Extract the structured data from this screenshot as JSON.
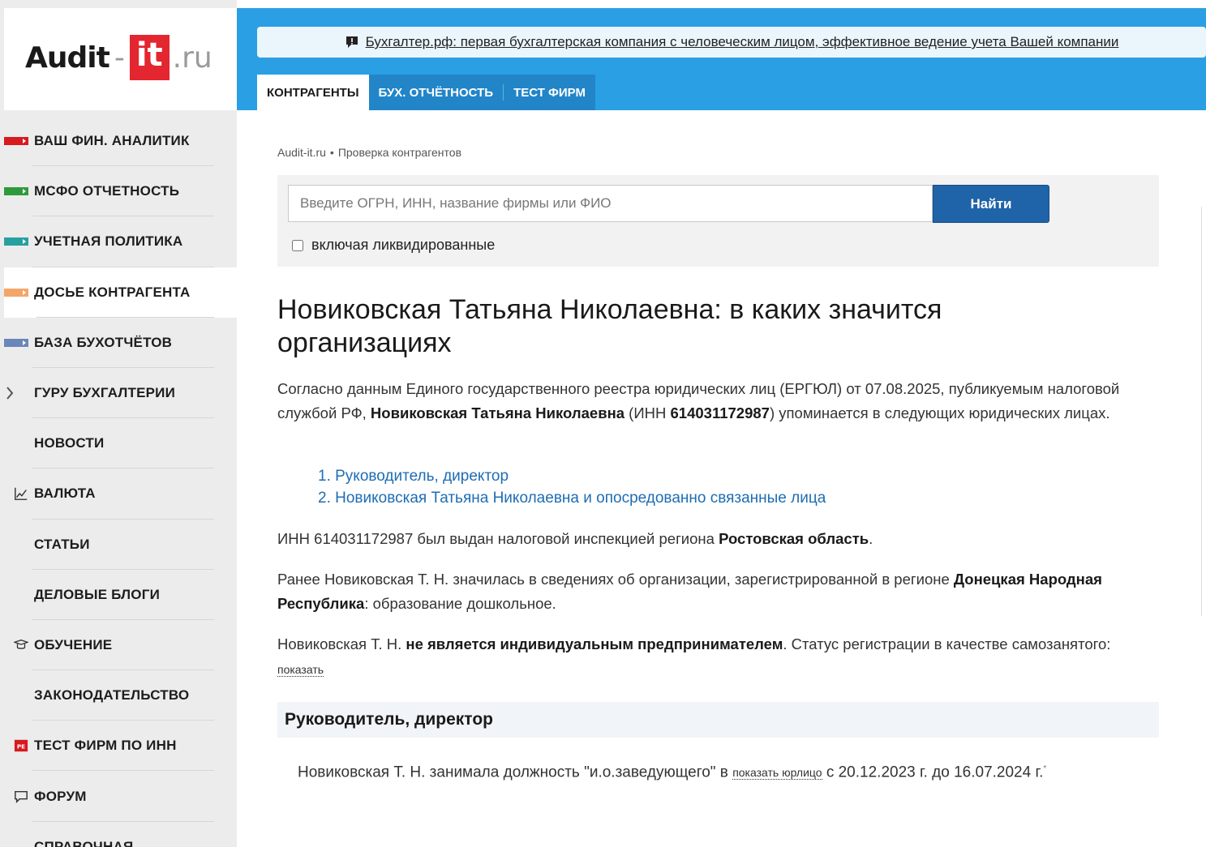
{
  "logo": {
    "audit": "Audit",
    "dash": "-",
    "it": "it",
    "ru": ".ru"
  },
  "nav": [
    {
      "label": "ВАШ ФИН. АНАЛИТИК",
      "icon": "bar",
      "color": "#d71920"
    },
    {
      "label": "МСФО ОТЧЕТНОСТЬ",
      "icon": "bar",
      "color": "#2e9a3c"
    },
    {
      "label": "УЧЕТНАЯ ПОЛИТИКА",
      "icon": "bar",
      "color": "#27a0a0"
    },
    {
      "label": "ДОСЬЕ КОНТРАГЕНТА",
      "icon": "bar",
      "color": "#f4a66a",
      "active": true
    },
    {
      "label": "БАЗА БУХОТЧЁТОВ",
      "icon": "bar",
      "color": "#6b86b8"
    },
    {
      "label": "ГУРУ БУХГАЛТЕРИИ",
      "icon": "chevron"
    },
    {
      "label": "НОВОСТИ",
      "icon": "none"
    },
    {
      "label": "ВАЛЮТА",
      "icon": "chart"
    },
    {
      "label": "СТАТЬИ",
      "icon": "none"
    },
    {
      "label": "ДЕЛОВЫЕ БЛОГИ",
      "icon": "none"
    },
    {
      "label": "ОБУЧЕНИЕ",
      "icon": "cap"
    },
    {
      "label": "ЗАКОНОДАТЕЛЬСТВО",
      "icon": "none"
    },
    {
      "label": "ТЕСТ ФИРМ ПО ИНН",
      "icon": "pe"
    },
    {
      "label": "ФОРУМ",
      "icon": "chat"
    },
    {
      "label": "СПРАВОЧНАЯ",
      "icon": "none"
    }
  ],
  "promo": {
    "text": "Бухгалтер.рф: первая бухгалтерская компания с человеческим лицом, эффективное ведение учета Вашей компании"
  },
  "tabs": [
    {
      "label": "КОНТРАГЕНТЫ",
      "active": true
    },
    {
      "label": "БУХ. ОТЧЁТНОСТЬ"
    },
    {
      "label": "ТЕСТ ФИРМ"
    }
  ],
  "breadcrumb": {
    "home": "Audit-it.ru",
    "dot": "•",
    "current": "Проверка контрагентов"
  },
  "search": {
    "placeholder": "Введите ОГРН, ИНН, название фирмы или ФИО",
    "button": "Найти",
    "checkbox_label": "включая ликвидированные"
  },
  "title": "Новиковская Татьяна Николаевна: в каких значится организациях",
  "p1": {
    "a": "Согласно данным Единого государственного реестра юридических лиц (ЕРГЮЛ) от 07.08.2025, публикуемым налоговой службой РФ, ",
    "name": "Новиковская Татьяна Николаевна",
    "b": " (ИНН ",
    "inn": "614031172987",
    "c": ") упоминается в следующих юридических лицах."
  },
  "toc": [
    "1. Руководитель, директор",
    "2. Новиковская Татьяна Николаевна и опосредованно связанные лица"
  ],
  "p2": {
    "a": "ИНН 614031172987 был выдан налоговой инспекцией региона ",
    "region": "Ростовская область",
    "b": "."
  },
  "p3": {
    "a": "Ранее Новиковская Т. Н. значилась в сведениях об организации, зарегистрированной в регионе ",
    "region": "Донецкая Народная Республика",
    "b": ": образование дошкольное."
  },
  "p4": {
    "a": "Новиковская Т. Н. ",
    "bold": "не является индивидуальным предпринимателем",
    "b": ". Статус регистрации в качестве самозанятого: ",
    "link": "показать"
  },
  "section": {
    "title": "Руководитель, директор"
  },
  "director": {
    "a": "Новиковская Т. Н. занимала должность \"и.о.заведующего\" в ",
    "link": "показать юрлицо",
    "b": " с 20.12.2023 г. до 16.07.2024 г.",
    "sup": "*"
  }
}
